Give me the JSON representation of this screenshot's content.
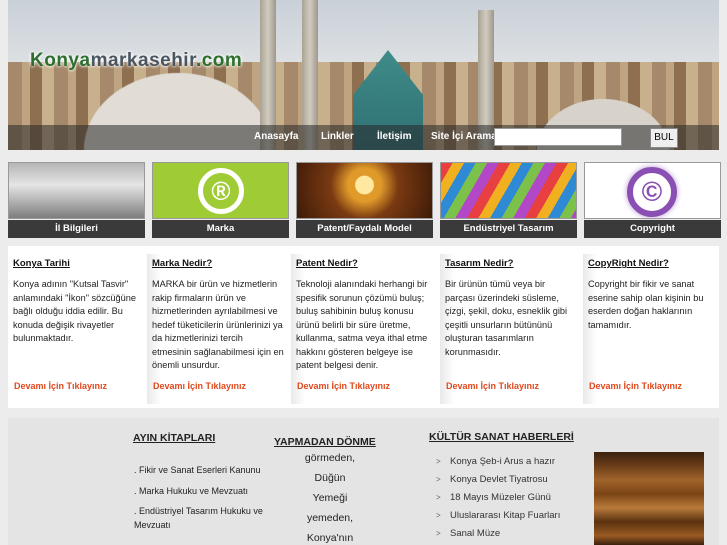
{
  "header": {
    "logo": {
      "part1": "Konya",
      "part2": "markasehir",
      "part3": ".com"
    },
    "nav": [
      {
        "label": "Anasayfa"
      },
      {
        "label": "Linkler"
      },
      {
        "label": "İletişim"
      }
    ],
    "search": {
      "label": "Site İçi Arama:",
      "value": "",
      "button": "BUL"
    }
  },
  "tiles": [
    {
      "caption": "İl Bilgileri"
    },
    {
      "caption": "Marka",
      "symbol": "®"
    },
    {
      "caption": "Patent/Faydalı Model"
    },
    {
      "caption": "Endüstriyel Tasarım"
    },
    {
      "caption": "Copyright",
      "symbol": "©"
    }
  ],
  "columns": [
    {
      "title": "Konya Tarihi",
      "text": "Konya adının \"Kutsal Tasvir\" anlamındaki \"İkon\" sözcüğüne bağlı olduğu iddia edilir. Bu konuda değişik rivayetler bulunmaktadır.",
      "more": "Devamı İçin Tıklayınız"
    },
    {
      "title": "Marka Nedir?",
      "text": "MARKA bir ürün ve hizmetlerin rakip firmaların ürün ve hizmetlerinden ayrılabilmesi ve hedef tüketicilerin ürünlerinizi ya da hizmetlerinizi tercih etmesinin sağlanabilmesi için en önemli unsurdur.",
      "more": "Devamı İçin Tıklayınız"
    },
    {
      "title": "Patent Nedir?",
      "text": "Teknoloji alanındaki herhangi bir spesifik sorunun çözümü buluş; buluş sahibinin buluş konusu ürünü belirli bir süre üretme, kullanma, satma veya ithal etme hakkını gösteren belgeye ise patent belgesi denir.",
      "more": "Devamı İçin Tıklayınız"
    },
    {
      "title": "Tasarım Nedir?",
      "text": "Bir ürünün tümü veya bir parçası üzerindeki süsleme, çizgi, şekil, doku, esneklik gibi çeşitli unsurların bütününü oluşturan tasarımların korunmasıdır.",
      "more": "Devamı İçin Tıklayınız"
    },
    {
      "title": "CopyRight Nedir?",
      "text": "Copyright bir fikir ve sanat eserine sahip olan kişinin bu eserden doğan haklarının tamamıdır.",
      "more": "Devamı İçin Tıklayınız"
    }
  ],
  "bottom": {
    "books": {
      "title": "AYIN KİTAPLARI",
      "items": [
        ". Fikir ve Sanat Eserleri Kanunu",
        ". Marka Hukuku ve Mevzuatı",
        ". Endüstriyel Tasarım Hukuku ve Mevzuatı"
      ]
    },
    "marquee": {
      "title": "YAPMADAN DÖNME",
      "lines": [
        "görmeden,",
        "Düğün",
        "Yemeği",
        "yemeden,",
        "Konya'nın"
      ]
    },
    "news": {
      "title": "KÜLTÜR SANAT HABERLERİ",
      "items": [
        "Konya Şeb-i Arus a hazır",
        "Konya Devlet Tiyatrosu",
        "18 Mayıs Müzeler Günü",
        "Uluslararası Kitap Fuarları",
        "Sanal Müze"
      ]
    }
  }
}
